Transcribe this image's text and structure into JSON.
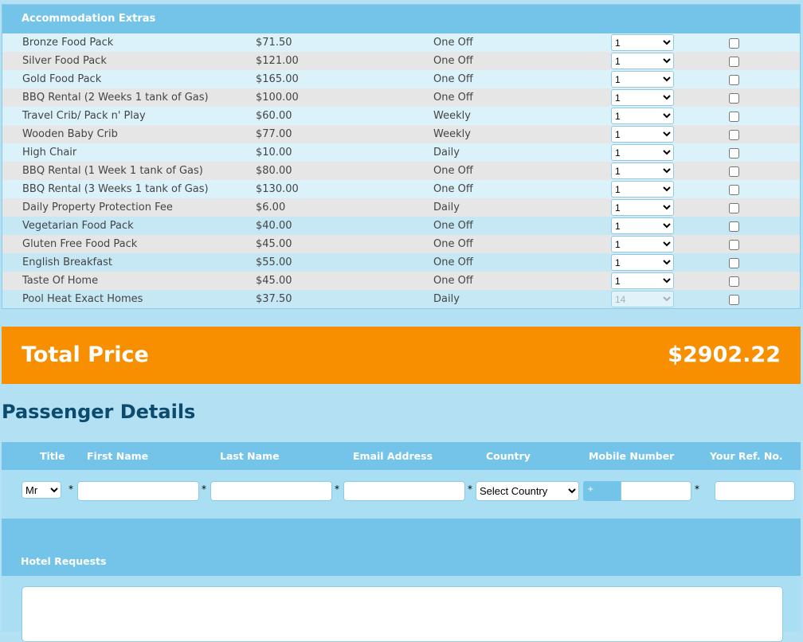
{
  "extras": {
    "title": "Accommodation Extras",
    "rows": [
      {
        "name": "Bronze Food Pack",
        "price": "$71.50",
        "freq": "One Off",
        "qty": "1"
      },
      {
        "name": "Silver Food Pack",
        "price": "$121.00",
        "freq": "One Off",
        "qty": "1"
      },
      {
        "name": "Gold Food Pack",
        "price": "$165.00",
        "freq": "One Off",
        "qty": "1"
      },
      {
        "name": "BBQ Rental (2 Weeks 1 tank of Gas)",
        "price": "$100.00",
        "freq": "One Off",
        "qty": "1"
      },
      {
        "name": "Travel Crib/ Pack n' Play",
        "price": "$60.00",
        "freq": "Weekly",
        "qty": "1"
      },
      {
        "name": "Wooden Baby Crib",
        "price": "$77.00",
        "freq": "Weekly",
        "qty": "1"
      },
      {
        "name": "High Chair",
        "price": "$10.00",
        "freq": "Daily",
        "qty": "1"
      },
      {
        "name": "BBQ Rental (1 Week 1 tank of Gas)",
        "price": "$80.00",
        "freq": "One Off",
        "qty": "1"
      },
      {
        "name": "BBQ Rental (3 Weeks 1 tank of Gas)",
        "price": "$130.00",
        "freq": "One Off",
        "qty": "1"
      },
      {
        "name": "Daily Property Protection Fee",
        "price": "$6.00",
        "freq": "Daily",
        "qty": "1"
      },
      {
        "name": "Vegetarian Food Pack",
        "price": "$40.00",
        "freq": "One Off",
        "qty": "1"
      },
      {
        "name": "Gluten Free Food Pack",
        "price": "$45.00",
        "freq": "One Off",
        "qty": "1"
      },
      {
        "name": "English Breakfast",
        "price": "$55.00",
        "freq": "One Off",
        "qty": "1"
      },
      {
        "name": "Taste Of Home",
        "price": "$45.00",
        "freq": "One Off",
        "qty": "1"
      },
      {
        "name": "Pool Heat Exact Homes",
        "price": "$37.50",
        "freq": "Daily",
        "qty": "14",
        "disabled": true
      }
    ]
  },
  "total": {
    "label": "Total Price",
    "value": "$2902.22"
  },
  "passenger": {
    "title": "Passenger Details",
    "headers": [
      "Title",
      "First Name",
      "Last Name",
      "Email Address",
      "Country",
      "Mobile Number",
      "Your Ref. No."
    ],
    "title_value": "Mr",
    "country_value": "Select Country",
    "phone_prefix": "+",
    "required_mark": "*"
  },
  "hotel_requests": {
    "label": "Hotel Requests"
  }
}
